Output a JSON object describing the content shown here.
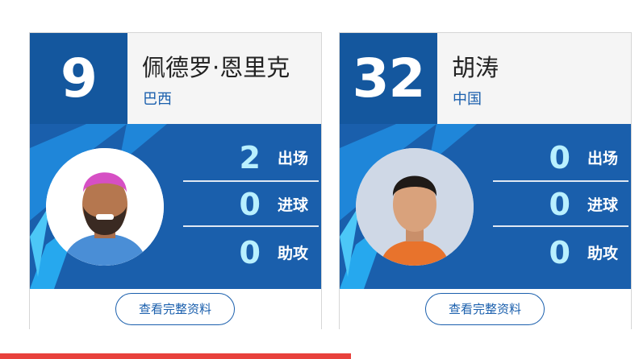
{
  "players": [
    {
      "number": "9",
      "name": "佩德罗·恩里克",
      "country": "巴西",
      "stats": [
        {
          "value": "2",
          "label": "出场"
        },
        {
          "value": "0",
          "label": "进球"
        },
        {
          "value": "0",
          "label": "助攻"
        }
      ],
      "button_label": "查看完整资料"
    },
    {
      "number": "32",
      "name": "胡涛",
      "country": "中国",
      "stats": [
        {
          "value": "0",
          "label": "出场"
        },
        {
          "value": "0",
          "label": "进球"
        },
        {
          "value": "0",
          "label": "助攻"
        }
      ],
      "button_label": "查看完整资料"
    }
  ],
  "colors": {
    "brand_blue": "#14579e",
    "stat_value": "#b9f0ff",
    "accent_red": "#e8413c"
  }
}
